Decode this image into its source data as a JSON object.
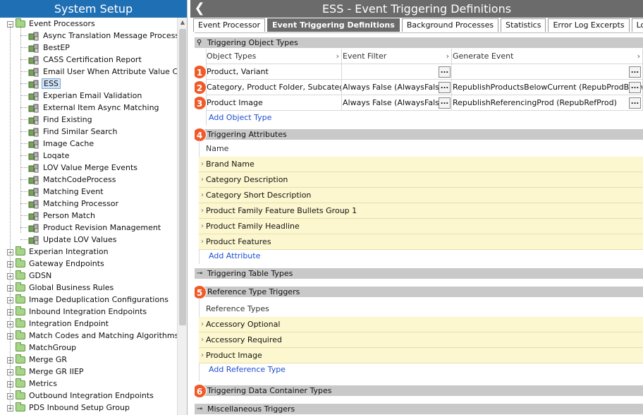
{
  "left_panel": {
    "title": "System Setup",
    "tree": [
      {
        "label": "Event Processors",
        "level": 0,
        "type": "folder",
        "expander": "minus"
      },
      {
        "label": "Async Translation Message Processor",
        "level": 1,
        "type": "ep"
      },
      {
        "label": "BestEP",
        "level": 1,
        "type": "ep"
      },
      {
        "label": "CASS Certification Report",
        "level": 1,
        "type": "ep"
      },
      {
        "label": "Email User When Attribute Value Chan",
        "level": 1,
        "type": "ep"
      },
      {
        "label": "ESS",
        "level": 1,
        "type": "ep",
        "selected": true
      },
      {
        "label": "Experian Email Validation",
        "level": 1,
        "type": "ep"
      },
      {
        "label": "External Item Async Matching",
        "level": 1,
        "type": "ep"
      },
      {
        "label": "Find Existing",
        "level": 1,
        "type": "ep"
      },
      {
        "label": "Find Similar Search",
        "level": 1,
        "type": "ep"
      },
      {
        "label": "Image Cache",
        "level": 1,
        "type": "ep"
      },
      {
        "label": "Loqate",
        "level": 1,
        "type": "ep"
      },
      {
        "label": "LOV Value Merge Events",
        "level": 1,
        "type": "ep"
      },
      {
        "label": "MatchCodeProcess",
        "level": 1,
        "type": "ep"
      },
      {
        "label": "Matching Event",
        "level": 1,
        "type": "ep"
      },
      {
        "label": "Matching Processor",
        "level": 1,
        "type": "ep"
      },
      {
        "label": "Person Match",
        "level": 1,
        "type": "ep"
      },
      {
        "label": "Product Revision Management",
        "level": 1,
        "type": "ep"
      },
      {
        "label": "Update LOV Values",
        "level": 1,
        "type": "ep"
      },
      {
        "label": "Experian Integration",
        "level": 0,
        "type": "folder",
        "expander": "plus"
      },
      {
        "label": "Gateway Endpoints",
        "level": 0,
        "type": "folder",
        "expander": "plus"
      },
      {
        "label": "GDSN",
        "level": 0,
        "type": "folder",
        "expander": "plus"
      },
      {
        "label": "Global Business Rules",
        "level": 0,
        "type": "folder",
        "expander": "plus"
      },
      {
        "label": "Image Deduplication Configurations",
        "level": 0,
        "type": "folder",
        "expander": "plus"
      },
      {
        "label": "Inbound Integration Endpoints",
        "level": 0,
        "type": "folder",
        "expander": "plus"
      },
      {
        "label": "Integration Endpoint",
        "level": 0,
        "type": "folder",
        "expander": "plus"
      },
      {
        "label": "Match Codes and Matching Algorithms",
        "level": 0,
        "type": "folder",
        "expander": "plus"
      },
      {
        "label": "MatchGroup",
        "level": 0,
        "type": "folder",
        "expander": "none"
      },
      {
        "label": "Merge GR",
        "level": 0,
        "type": "folder",
        "expander": "plus"
      },
      {
        "label": "Merge GR IIEP",
        "level": 0,
        "type": "folder",
        "expander": "plus"
      },
      {
        "label": "Metrics",
        "level": 0,
        "type": "folder",
        "expander": "plus"
      },
      {
        "label": "Outbound Integration Endpoints",
        "level": 0,
        "type": "folder",
        "expander": "plus"
      },
      {
        "label": "PDS Inbound Setup Group",
        "level": 0,
        "type": "folder",
        "expander": "plus"
      }
    ]
  },
  "right_panel": {
    "title": "ESS - Event Triggering Definitions",
    "tabs": [
      {
        "label": "Event Processor",
        "active": false
      },
      {
        "label": "Event Triggering Definitions",
        "active": true
      },
      {
        "label": "Background Processes",
        "active": false
      },
      {
        "label": "Statistics",
        "active": false
      },
      {
        "label": "Error Log Excerpts",
        "active": false
      },
      {
        "label": "Log",
        "active": false
      }
    ],
    "object_types": {
      "title": "Triggering Object Types",
      "columns": [
        "Object Types",
        "Event Filter",
        "Generate Event"
      ],
      "rows": [
        {
          "badge": "1",
          "object_types": "Product, Variant",
          "event_filter": "",
          "generate_event": ""
        },
        {
          "badge": "2",
          "object_types": "Category, Product Folder, Subcategory",
          "event_filter": "Always False (AlwaysFalse)",
          "generate_event": "RepublishProductsBelowCurrent (RepubProdBelow)"
        },
        {
          "badge": "3",
          "object_types": "Product Image",
          "event_filter": "Always False (AlwaysFalse)",
          "generate_event": "RepublishReferencingProd (RepubRefProd)"
        }
      ],
      "ellipsis": "...",
      "add_link": "Add Object Type"
    },
    "attributes": {
      "badge": "4",
      "title": "Triggering Attributes",
      "column": "Name",
      "rows": [
        "Brand Name",
        "Category Description",
        "Category Short Description",
        "Product Family Feature Bullets Group 1",
        "Product Family Headline",
        "Product Features"
      ],
      "add_link": "Add Attribute"
    },
    "table_types": {
      "title": "Triggering Table Types"
    },
    "reference_types": {
      "badge": "5",
      "title": "Reference Type Triggers",
      "column": "Reference Types",
      "rows": [
        "Accessory Optional",
        "Accessory Required",
        "Product Image"
      ],
      "add_link": "Add Reference Type"
    },
    "data_container_types": {
      "badge": "6",
      "title": "Triggering Data Container Types"
    },
    "misc": {
      "title": "Miscellaneous Triggers"
    }
  },
  "colors": {
    "left_header": "#1f6fb5",
    "right_header": "#6b6b6b",
    "badge": "#f05a28",
    "row_highlight": "#fcf7cf"
  }
}
